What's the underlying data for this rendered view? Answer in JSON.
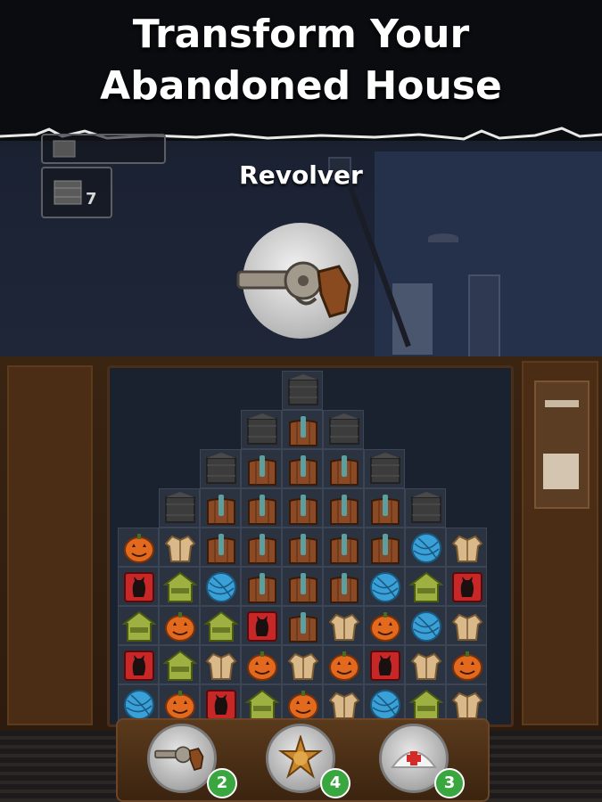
{
  "banner": {
    "title_line1": "Transform Your",
    "title_line2": "Abandoned House"
  },
  "found_item": {
    "name": "Revolver",
    "icon": "revolver-icon"
  },
  "side_slots": [
    {
      "icon": "crate-icon",
      "count": ""
    },
    {
      "icon": "crate-icon",
      "count": "7"
    }
  ],
  "boosters": [
    {
      "icon": "revolver-icon",
      "count": "2"
    },
    {
      "icon": "sheriff-badge-icon",
      "count": "4"
    },
    {
      "icon": "nurse-cap-icon",
      "count": "3"
    }
  ],
  "board": {
    "rows": [
      [
        "",
        "",
        "",
        "",
        "crate",
        "",
        "",
        "",
        ""
      ],
      [
        "",
        "",
        "",
        "crate",
        "wood",
        "crate",
        "",
        "",
        ""
      ],
      [
        "",
        "",
        "crate",
        "wood",
        "wood",
        "wood",
        "crate",
        "",
        ""
      ],
      [
        "",
        "crate",
        "wood",
        "wood",
        "wood",
        "wood",
        "wood",
        "crate",
        ""
      ],
      [
        "pumpkin",
        "coat",
        "wood",
        "wood",
        "wood",
        "wood",
        "wood",
        "yarn",
        "coat"
      ],
      [
        "cat",
        "house",
        "yarn",
        "wood",
        "wood",
        "wood",
        "yarn",
        "house",
        "cat"
      ],
      [
        "house",
        "pumpkin",
        "house",
        "cat",
        "wood",
        "coat",
        "pumpkin",
        "yarn",
        "coat"
      ],
      [
        "cat",
        "house",
        "coat",
        "pumpkin",
        "coat",
        "pumpkin",
        "cat",
        "coat",
        "pumpkin"
      ],
      [
        "yarn",
        "pumpkin",
        "cat",
        "house",
        "pumpkin",
        "coat",
        "yarn",
        "house",
        "coat"
      ]
    ]
  },
  "colors": {
    "pumpkin": "#e2691e",
    "coat": "#d9b98a",
    "yarn": "#3aa0d8",
    "cat": "#c72727",
    "house": "#9fb042",
    "wood": "#8a4a25",
    "crate": "#3c3c3c",
    "badge_green": "#3aa640"
  }
}
